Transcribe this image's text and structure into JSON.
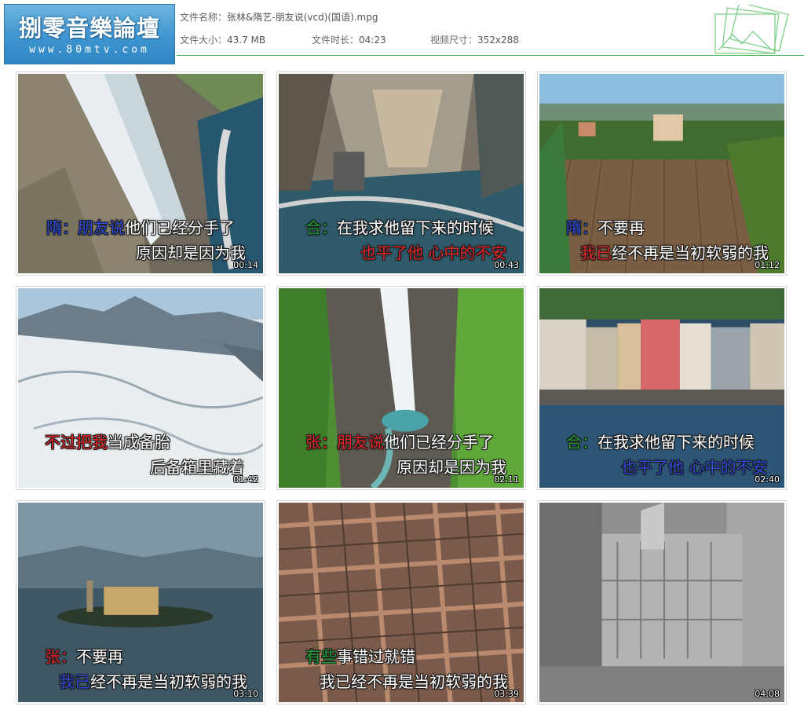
{
  "header": {
    "logo_title": "捌零音樂論壇",
    "logo_url": "www.80mtv.com",
    "filename_label": "文件名称：",
    "filename": "张林&隋艺-朋友说(vcd)(国语).mpg",
    "size_label": "文件大小：",
    "size": "43.7 MB",
    "duration_label": "文件时长：",
    "duration": "04:23",
    "resolution_label": "视频尺寸：",
    "resolution": "352x288"
  },
  "colors": {
    "logo_bg": "#3f95cf",
    "header_line": "#3fae49",
    "lyric_blue": "#2b49d6",
    "lyric_red": "#e0262b",
    "lyric_green": "#1f9a35"
  },
  "thumbnails": [
    {
      "time": "00:14",
      "line1_tag": "隋：",
      "line1_hl": "朋友说",
      "line1_rest": "他们已经分手了",
      "line2_hl": "",
      "line2_rest": "原因却是因为我"
    },
    {
      "time": "00:43",
      "line1_tag": "合：",
      "line1_hl": "",
      "line1_rest": "在我求他留下来的时候",
      "line2_hl": "也平了他 心中的不安",
      "line2_rest": ""
    },
    {
      "time": "01:12",
      "line1_tag": "隋：",
      "line1_hl": "",
      "line1_rest": "不要再",
      "line2_hl": "我已",
      "line2_rest": "经不再是当初软弱的我"
    },
    {
      "time": "01:42",
      "line1_tag": "",
      "line1_hl": "不过把我",
      "line1_rest": "当成备胎",
      "line2_hl": "",
      "line2_rest": "后备箱里藏着"
    },
    {
      "time": "02:11",
      "line1_tag": "张：",
      "line1_hl": "朋友说",
      "line1_rest": "他们已经分手了",
      "line2_hl": "",
      "line2_rest": "原因却是因为我"
    },
    {
      "time": "02:40",
      "line1_tag": "合：",
      "line1_hl": "",
      "line1_rest": "在我求他留下来的时候",
      "line2_hl": "也平了他 心中的不安",
      "line2_rest": ""
    },
    {
      "time": "03:10",
      "line1_tag": "张：",
      "line1_hl": "",
      "line1_rest": "不要再",
      "line2_hl": "我已",
      "line2_rest": "经不再是当初软弱的我"
    },
    {
      "time": "03:39",
      "line1_tag": "",
      "line1_hl": "有些",
      "line1_rest": "事错过就错",
      "line2_hl": "",
      "line2_rest": "我已经不再是当初软弱的我"
    },
    {
      "time": "04:08",
      "line1_tag": "",
      "line1_hl": "",
      "line1_rest": "",
      "line2_hl": "",
      "line2_rest": ""
    }
  ]
}
